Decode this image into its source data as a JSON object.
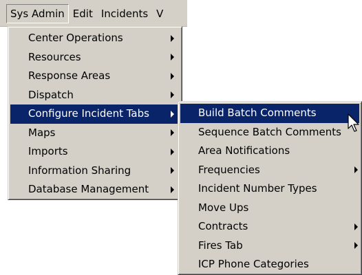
{
  "menubar": {
    "items": [
      {
        "label": "Sys Admin"
      },
      {
        "label": "Edit"
      },
      {
        "label": "Incidents"
      },
      {
        "label": "V"
      }
    ]
  },
  "sysadmin_menu": {
    "items": [
      {
        "label": "Center Operations",
        "has_submenu": true
      },
      {
        "label": "Resources",
        "has_submenu": true
      },
      {
        "label": "Response Areas",
        "has_submenu": true
      },
      {
        "label": "Dispatch",
        "has_submenu": true
      },
      {
        "label": "Configure Incident Tabs",
        "has_submenu": true,
        "highlighted": true
      },
      {
        "label": "Maps",
        "has_submenu": true
      },
      {
        "label": "Imports",
        "has_submenu": true
      },
      {
        "label": "Information Sharing",
        "has_submenu": true
      },
      {
        "label": "Database Management",
        "has_submenu": true
      }
    ]
  },
  "incident_tabs_submenu": {
    "items": [
      {
        "label": "Build Batch Comments",
        "has_submenu": false,
        "highlighted": true
      },
      {
        "label": "Sequence Batch Comments",
        "has_submenu": false
      },
      {
        "label": "Area Notifications",
        "has_submenu": false
      },
      {
        "label": "Frequencies",
        "has_submenu": true
      },
      {
        "label": "Incident Number Types",
        "has_submenu": false
      },
      {
        "label": "Move Ups",
        "has_submenu": false
      },
      {
        "label": "Contracts",
        "has_submenu": true
      },
      {
        "label": "Fires Tab",
        "has_submenu": true
      },
      {
        "label": "ICP Phone Categories",
        "has_submenu": false
      }
    ]
  },
  "colors": {
    "menu_background": "#d4d0c8",
    "highlight_background": "#0a246a",
    "highlight_text": "#ffffff"
  },
  "icons": {
    "submenu_indicator": "triangle-right",
    "cursor": "mouse-pointer-arrow"
  }
}
